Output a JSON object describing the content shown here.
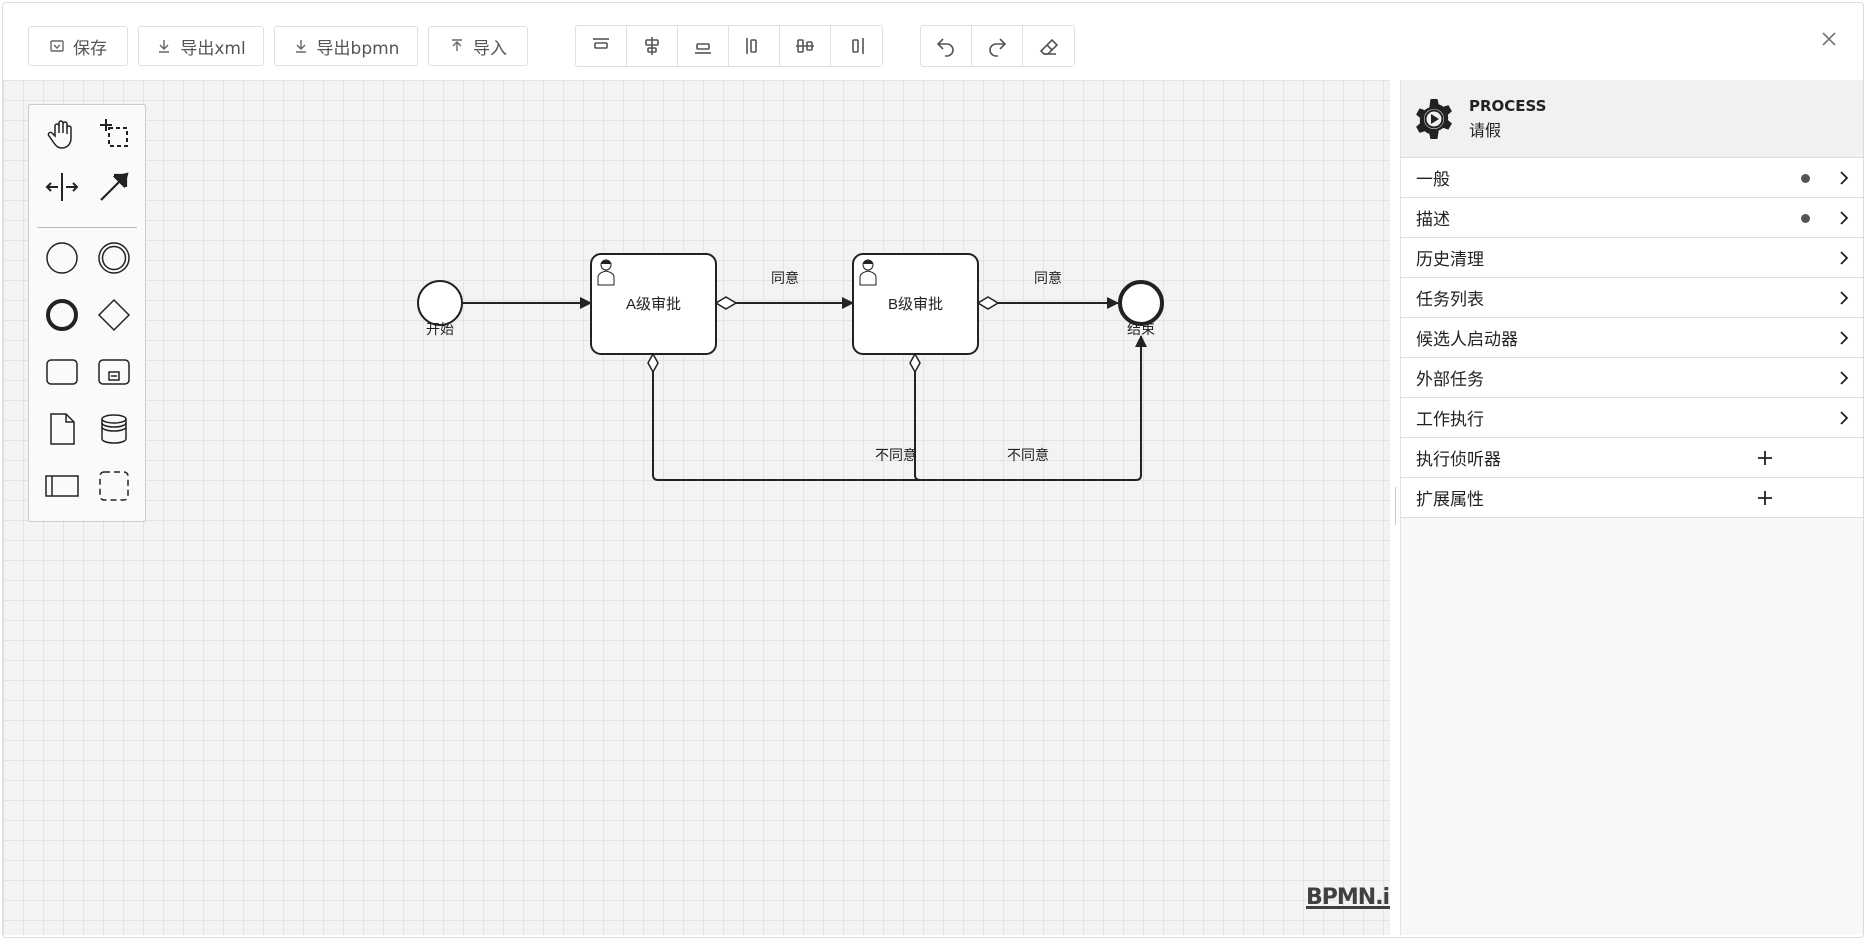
{
  "toolbar": {
    "save_label": "保存",
    "export_xml_label": "导出xml",
    "export_bpmn_label": "导出bpmn",
    "import_label": "导入",
    "align_icons": [
      "align-top-icon",
      "align-middle-icon",
      "align-bottom-icon",
      "align-left-icon",
      "align-center-icon",
      "align-right-icon"
    ],
    "history_icons": [
      "undo-icon",
      "redo-icon",
      "eraser-icon"
    ]
  },
  "palette": {
    "tools": [
      "hand-tool-icon",
      "lasso-tool-icon",
      "space-tool-icon",
      "connect-tool-icon",
      "start-event-icon",
      "intermediate-event-icon",
      "end-event-icon",
      "gateway-icon",
      "task-icon",
      "subprocess-icon",
      "data-object-icon",
      "data-store-icon",
      "pool-icon",
      "group-icon"
    ]
  },
  "diagram": {
    "start_label": "开始",
    "end_label": "结束",
    "task_a": "A级审批",
    "task_b": "B级审批",
    "flow_agree_1": "同意",
    "flow_agree_2": "同意",
    "flow_disagree_1": "不同意",
    "flow_disagree_2": "不同意"
  },
  "watermark": "BPMN.io",
  "panel": {
    "element_type": "PROCESS",
    "element_name": "请假",
    "groups": [
      {
        "label": "一般",
        "has_dot": true,
        "action": "chevron"
      },
      {
        "label": "描述",
        "has_dot": true,
        "action": "chevron"
      },
      {
        "label": "历史清理",
        "has_dot": false,
        "action": "chevron"
      },
      {
        "label": "任务列表",
        "has_dot": false,
        "action": "chevron"
      },
      {
        "label": "候选人启动器",
        "has_dot": false,
        "action": "chevron"
      },
      {
        "label": "外部任务",
        "has_dot": false,
        "action": "chevron"
      },
      {
        "label": "工作执行",
        "has_dot": false,
        "action": "chevron"
      },
      {
        "label": "执行侦听器",
        "has_dot": false,
        "action": "plus"
      },
      {
        "label": "扩展属性",
        "has_dot": false,
        "action": "plus"
      }
    ]
  },
  "colors": {
    "stroke": "#222222",
    "canvas_bg": "#f3f3f3",
    "grid": "#e3e3e3",
    "panel_bg": "#f8f8f8"
  }
}
